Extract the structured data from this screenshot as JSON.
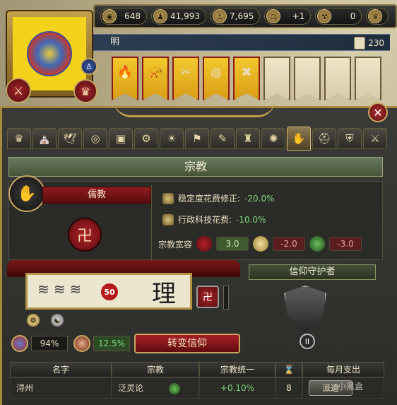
{
  "topbar": {
    "resources": [
      {
        "icon": "coin-icon",
        "glyph": "◉",
        "value": "648"
      },
      {
        "icon": "manpower-icon",
        "glyph": "♟",
        "value": "41,993"
      },
      {
        "icon": "sailors-icon",
        "glyph": "⚓",
        "value": "7,695"
      },
      {
        "icon": "stability-icon",
        "glyph": "⚖",
        "value": "+1"
      },
      {
        "icon": "corruption-icon",
        "glyph": "☢",
        "value": "0"
      },
      {
        "icon": "crown-icon",
        "glyph": "♛",
        "value": ""
      }
    ]
  },
  "country": {
    "name": "明",
    "prestige": "230"
  },
  "religion": {
    "title": "宗教",
    "name": "儒教",
    "modifiers": [
      {
        "label": "稳定度花费修正: ",
        "value": "-20.0%"
      },
      {
        "label": "行政科技花费: ",
        "value": "-10.0%"
      }
    ],
    "tolerance_label": "宗教宽容",
    "tolerance_values": [
      "3.0",
      "-2.0",
      "-3.0"
    ],
    "harmony_value": "50",
    "calligraphy_char": "理",
    "defender_label": "信仰守护者",
    "defender_rank": "II",
    "stat_1": "94%",
    "stat_2": "12.5%",
    "convert_label": "转变信仰"
  },
  "table": {
    "headers": [
      "名字",
      "宗教",
      "宗教统一",
      "⌛",
      "每月支出"
    ],
    "rows": [
      {
        "name": "浔州",
        "religion": "泛灵论",
        "unity": "+0.10%",
        "time": "8",
        "action": "派遣"
      }
    ]
  },
  "watermark": "小黑盒"
}
